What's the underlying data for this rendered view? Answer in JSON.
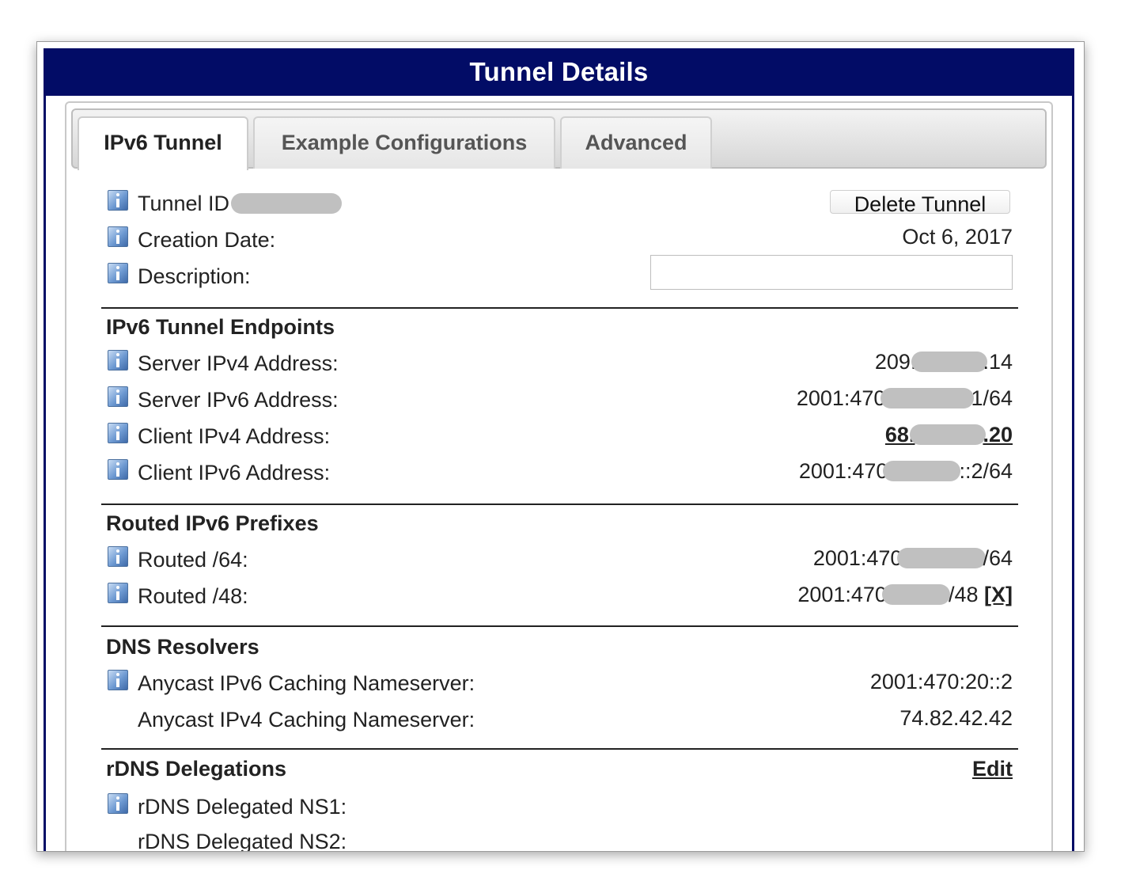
{
  "window": {
    "title": "Tunnel Details"
  },
  "tabs": [
    {
      "label": "IPv6 Tunnel",
      "active": true
    },
    {
      "label": "Example Configurations",
      "active": false
    },
    {
      "label": "Advanced",
      "active": false
    }
  ],
  "general": {
    "tunnel_id_label": "Tunnel ID",
    "tunnel_id_value": "",
    "delete_button": "Delete Tunnel",
    "creation_date_label": "Creation Date:",
    "creation_date_value": "Oct 6, 2017",
    "description_label": "Description:",
    "description_value": ""
  },
  "endpoints": {
    "title": "IPv6 Tunnel Endpoints",
    "server_ipv4_label": "Server IPv4 Address:",
    "server_ipv4_prefix": "209.",
    "server_ipv4_suffix": ".14",
    "server_ipv6_label": "Server IPv6 Address:",
    "server_ipv6_prefix": "2001:470",
    "server_ipv6_suffix": "1/64",
    "client_ipv4_label": "Client IPv4 Address:",
    "client_ipv4_prefix": "68.",
    "client_ipv4_suffix": ".20",
    "client_ipv6_label": "Client IPv6 Address:",
    "client_ipv6_prefix": "2001:470",
    "client_ipv6_suffix": "::2/64"
  },
  "routed": {
    "title": "Routed IPv6 Prefixes",
    "routed64_label": "Routed /64:",
    "routed64_prefix": "2001:470",
    "routed64_suffix": "/64",
    "routed48_label": "Routed /48:",
    "routed48_prefix": "2001:470",
    "routed48_suffix": "/48",
    "routed48_remove": "[X]"
  },
  "dns": {
    "title": "DNS Resolvers",
    "ipv6_label": "Anycast IPv6 Caching Nameserver:",
    "ipv6_value": "2001:470:20::2",
    "ipv4_label": "Anycast IPv4 Caching Nameserver:",
    "ipv4_value": "74.82.42.42"
  },
  "rdns": {
    "title": "rDNS Delegations",
    "edit_label": "Edit",
    "ns1_label": "rDNS Delegated NS1:",
    "ns2_label": "rDNS Delegated NS2:"
  },
  "colors": {
    "title_bar": "#020c66",
    "redaction": "#c0c0c0"
  }
}
